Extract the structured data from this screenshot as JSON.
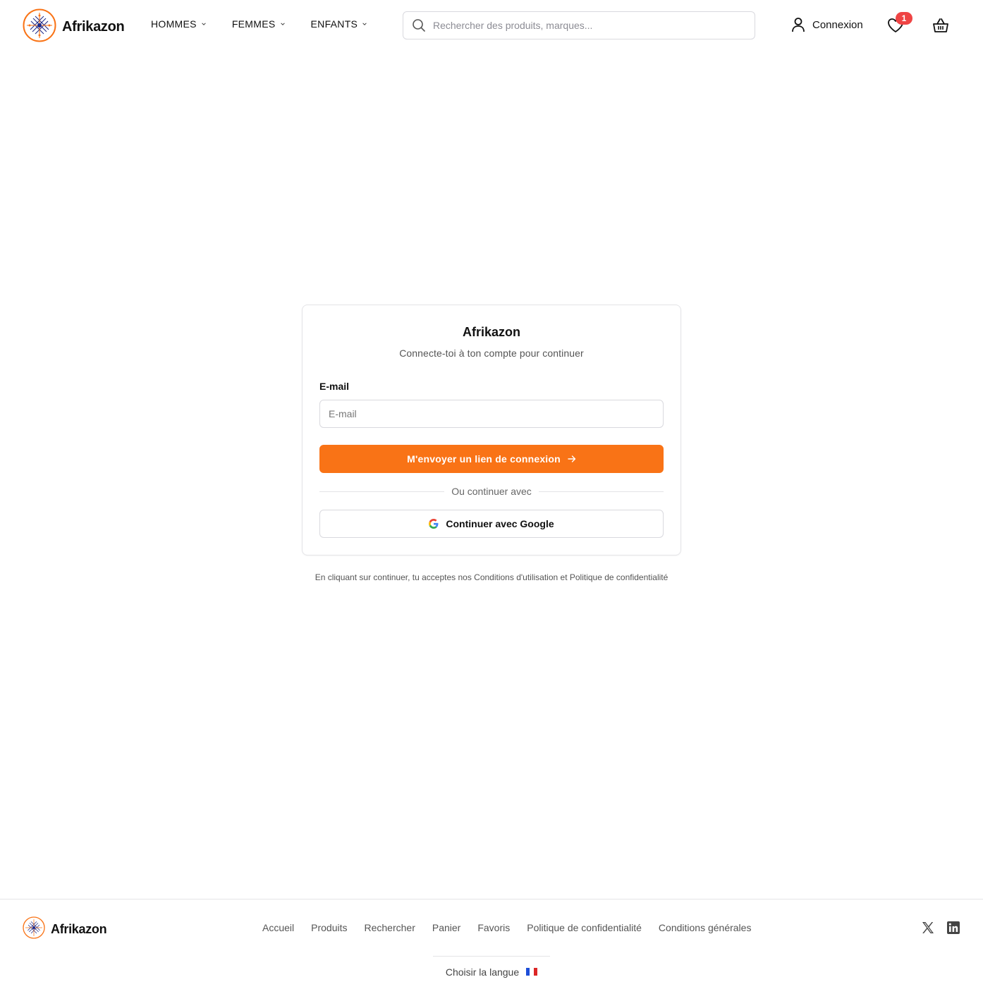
{
  "header": {
    "brand": "Afrikazon",
    "nav": [
      {
        "label": "HOMMES"
      },
      {
        "label": "FEMMES"
      },
      {
        "label": "ENFANTS"
      }
    ],
    "search_placeholder": "Rechercher des produits, marques...",
    "login_label": "Connexion",
    "favorites_count": "1"
  },
  "card": {
    "title": "Afrikazon",
    "subtitle": "Connecte-toi à ton compte pour continuer",
    "email_label": "E-mail",
    "email_placeholder": "E-mail",
    "email_value": "",
    "submit_label": "M'envoyer un lien de connexion",
    "divider_text": "Ou continuer avec",
    "google_label": "Continuer avec Google"
  },
  "terms": "En cliquant sur continuer, tu acceptes nos Conditions d'utilisation et Politique de confidentialité",
  "footer": {
    "brand": "Afrikazon",
    "links": [
      {
        "label": "Accueil"
      },
      {
        "label": "Produits"
      },
      {
        "label": "Rechercher"
      },
      {
        "label": "Panier"
      },
      {
        "label": "Favoris"
      },
      {
        "label": "Politique de confidentialité"
      },
      {
        "label": "Conditions générales"
      }
    ],
    "language_label": "Choisir la langue"
  },
  "colors": {
    "accent": "#f97316",
    "badge": "#ef4444",
    "logo_blue": "#1e2a8a",
    "logo_orange": "#f97316"
  }
}
